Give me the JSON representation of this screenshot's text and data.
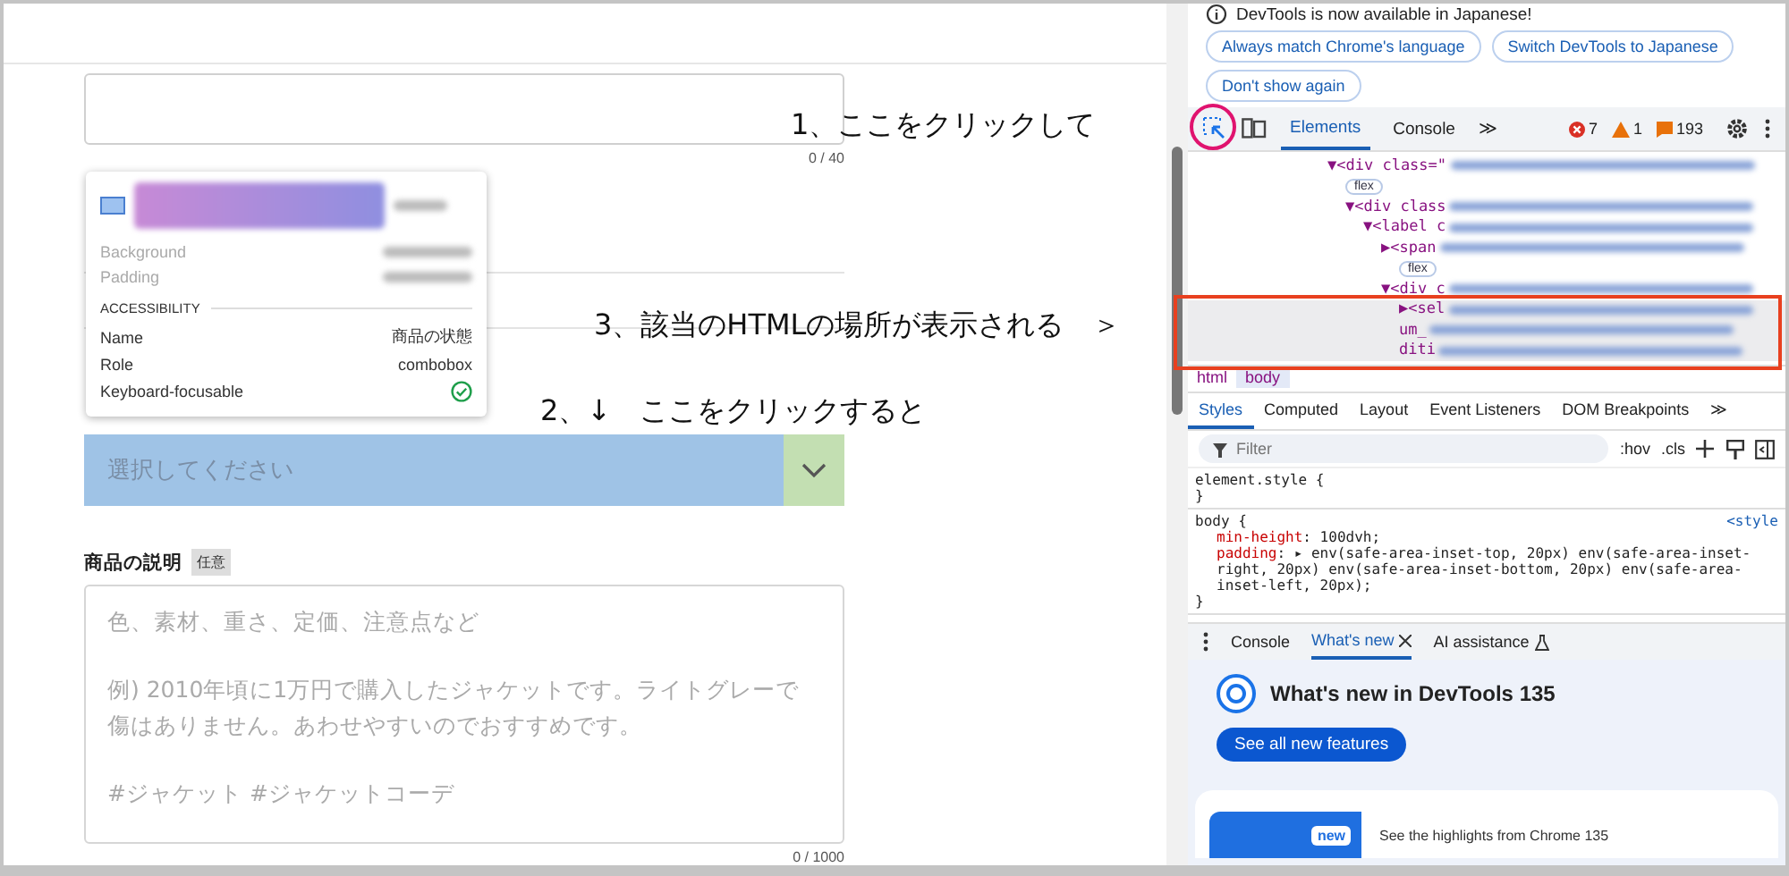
{
  "page": {
    "title_field": {
      "counter": "0 / 40"
    },
    "condition_select": {
      "placeholder": "選択してください",
      "highlighted": true
    },
    "description": {
      "label": "商品の説明",
      "badge": "任意",
      "placeholder": [
        "色、素材、重さ、定価、注意点など",
        "例) 2010年頃に1万円で購入したジャケットです。ライトグレーで傷はありません。あわせやすいのでおすすめです。",
        "#ジャケット #ジャケットコーデ"
      ],
      "counter": "0 / 1000"
    }
  },
  "inspect_tooltip": {
    "style_rows": [
      {
        "label": "Background"
      },
      {
        "label": "Padding"
      }
    ],
    "heading": "ACCESSIBILITY",
    "rows": [
      {
        "label": "Name",
        "value": "商品の状態",
        "kind": "text"
      },
      {
        "label": "Role",
        "value": "combobox",
        "kind": "text"
      },
      {
        "label": "Keyboard-focusable",
        "kind": "check"
      }
    ]
  },
  "annotations": [
    {
      "text": "1、ここをクリックして"
    },
    {
      "text": "3、該当のHTMLの場所が表示される　＞"
    },
    {
      "text": "2、↓　ここをクリックすると"
    }
  ],
  "devtools": {
    "notice": "DevTools is now available in Japanese!",
    "notice_buttons": [
      "Always match Chrome's language",
      "Switch DevTools to Japanese",
      "Don't show again"
    ],
    "inspect_active": true,
    "tabs": [
      {
        "label": "Elements",
        "selected": true
      },
      {
        "label": "Console",
        "selected": false
      }
    ],
    "more_tabs": "≫",
    "errors": "7",
    "warnings": "1",
    "issues": "193",
    "dom_tree": [
      {
        "lines": [
          "▼<div class=\""
        ],
        "badge": "flex",
        "selected": false,
        "children": [
          {
            "lines": [
              "▼<div class"
            ],
            "selected": false,
            "children": [
              {
                "lines": [
                  "▼<label c"
                ],
                "selected": false,
                "children": [
                  {
                    "lines": [
                      "▶<span"
                    ],
                    "badge": "flex",
                    "selected": false
                  },
                  {
                    "lines": [
                      "▼<div c"
                    ],
                    "selected": false,
                    "children": [
                      {
                        "lines": [
                          "▶<sel",
                          "um_",
                          "diti"
                        ],
                        "selected": true
                      }
                    ]
                  }
                ]
              }
            ]
          }
        ]
      }
    ],
    "breadcrumbs": [
      {
        "label": "html",
        "selected": false
      },
      {
        "label": "body",
        "selected": true
      }
    ],
    "style_tabs": [
      {
        "label": "Styles",
        "selected": true
      },
      {
        "label": "Computed",
        "selected": false
      },
      {
        "label": "Layout",
        "selected": false
      },
      {
        "label": "Event Listeners",
        "selected": false
      },
      {
        "label": "DOM Breakpoints",
        "selected": false
      }
    ],
    "filter": {
      "placeholder": "Filter"
    },
    "hov": ":hov",
    "cls": ".cls",
    "rules": [
      {
        "selector": "element.style {",
        "close": "}"
      },
      {
        "selector": "body {",
        "source": "<style",
        "props": [
          {
            "name": "min-height",
            "value": ": 100dvh;"
          },
          {
            "name": "padding",
            "value": ": ▸ env(safe-area-inset-top, 20px) env(safe-area-inset-right, 20px) env(safe-area-inset-bottom, 20px) env(safe-area-inset-left, 20px);"
          }
        ],
        "close": "}"
      }
    ],
    "drawer_tabs": [
      {
        "label": "Console",
        "selected": false,
        "closable": false,
        "kind": "plain"
      },
      {
        "label": "What's new",
        "selected": true,
        "closable": true,
        "kind": "plain"
      },
      {
        "label": "AI assistance",
        "selected": false,
        "closable": false,
        "kind": "ai"
      }
    ],
    "whats_new": {
      "title": "What's new in DevTools 135",
      "button": "See all new features",
      "badge": "new",
      "highlight": "See the highlights from Chrome 135"
    }
  }
}
